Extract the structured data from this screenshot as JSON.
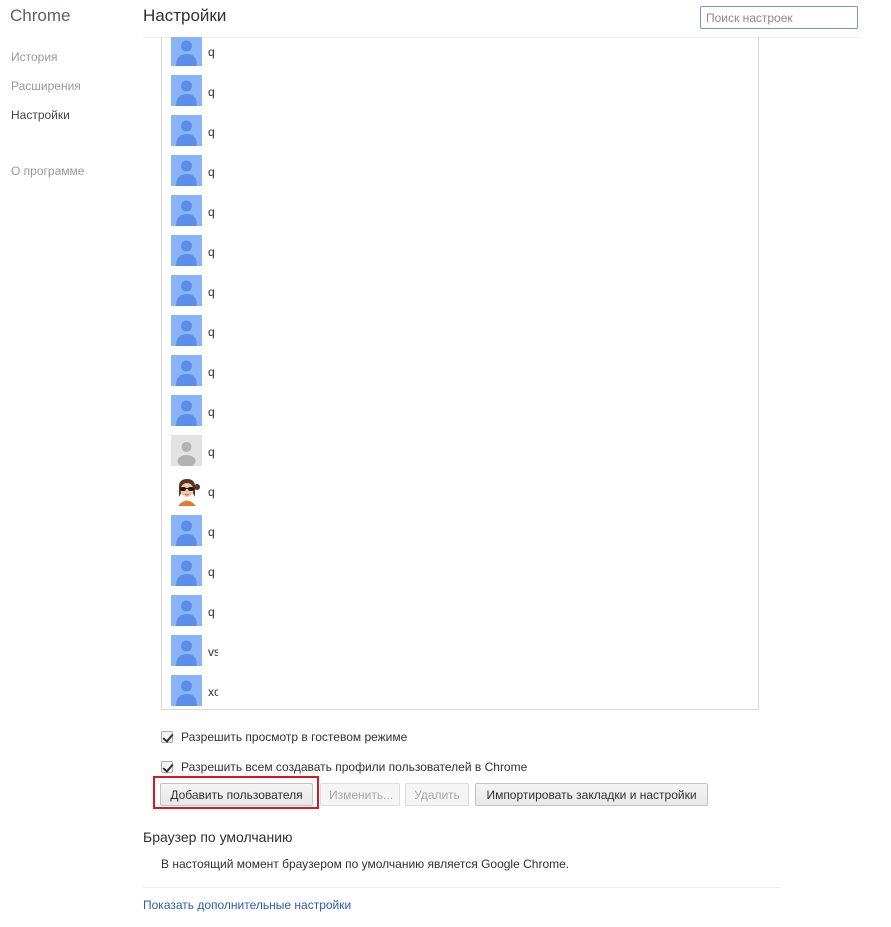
{
  "sidebar": {
    "brand": "Chrome",
    "items": [
      {
        "label": "История"
      },
      {
        "label": "Расширения"
      },
      {
        "label": "Настройки"
      },
      {
        "label": "О программе"
      }
    ]
  },
  "header": {
    "title": "Настройки",
    "search_placeholder": "Поиск настроек"
  },
  "profiles": [
    {
      "name": "q",
      "avatar": "blue-person-icon"
    },
    {
      "name": "q",
      "avatar": "blue-person-icon"
    },
    {
      "name": "q",
      "avatar": "blue-person-icon"
    },
    {
      "name": "q",
      "avatar": "blue-person-icon"
    },
    {
      "name": "q",
      "avatar": "blue-person-icon"
    },
    {
      "name": "q",
      "avatar": "blue-person-icon"
    },
    {
      "name": "q",
      "avatar": "blue-person-icon"
    },
    {
      "name": "q",
      "avatar": "blue-person-icon"
    },
    {
      "name": "q",
      "avatar": "blue-person-icon"
    },
    {
      "name": "q",
      "avatar": "blue-person-icon"
    },
    {
      "name": "q",
      "avatar": "gray-silhouette-icon"
    },
    {
      "name": "q",
      "avatar": "girl-avatar-icon"
    },
    {
      "name": "q",
      "avatar": "blue-person-icon"
    },
    {
      "name": "q",
      "avatar": "blue-person-icon"
    },
    {
      "name": "q",
      "avatar": "blue-person-icon"
    },
    {
      "name": "vs",
      "avatar": "blue-person-icon"
    },
    {
      "name": "xc",
      "avatar": "blue-person-icon"
    }
  ],
  "checkboxes": {
    "guest_mode": "Разрешить просмотр в гостевом режиме",
    "allow_profiles": "Разрешить всем создавать профили пользователей в Chrome"
  },
  "buttons": {
    "add_user": "Добавить пользователя",
    "edit": "Изменить...",
    "delete": "Удалить",
    "import": "Импортировать закладки и настройки"
  },
  "default_browser": {
    "title": "Браузер по умолчанию",
    "text": "В настоящий момент браузером по умолчанию является Google Chrome."
  },
  "advanced_link": "Показать дополнительные настройки",
  "colors": {
    "avatar_blue": "#5a8ee8",
    "avatar_blue_bg": "#8ab4f8",
    "link": "#2a5db0",
    "highlight": "#d7191f"
  }
}
